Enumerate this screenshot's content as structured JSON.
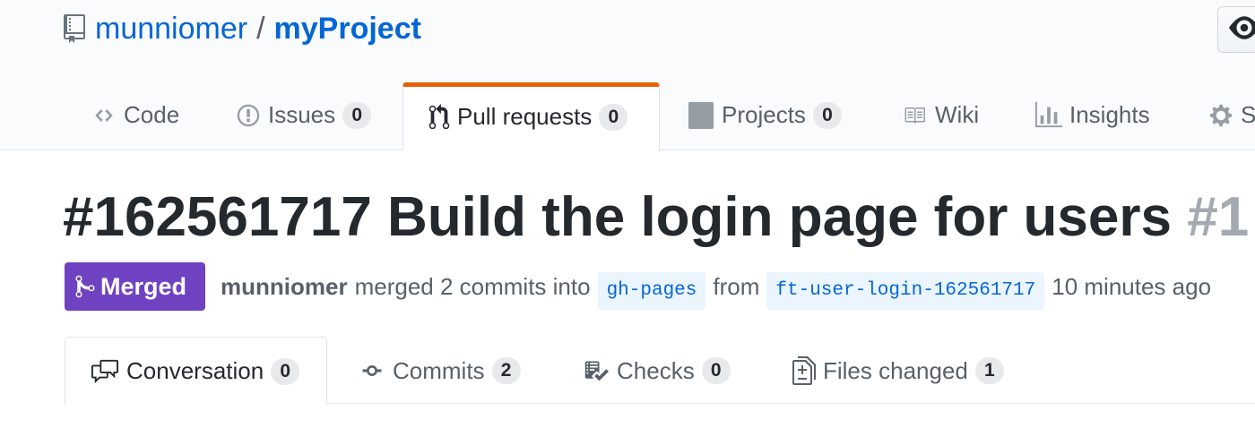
{
  "repo": {
    "owner": "munniomer",
    "separator": "/",
    "name": "myProject",
    "watch_icon": "eye-icon"
  },
  "reponav": {
    "items": [
      {
        "label": "Code",
        "icon": "code-icon",
        "count": null
      },
      {
        "label": "Issues",
        "icon": "issue-icon",
        "count": "0"
      },
      {
        "label": "Pull requests",
        "icon": "pull-request-icon",
        "count": "0",
        "selected": true
      },
      {
        "label": "Projects",
        "icon": "project-icon",
        "count": "0"
      },
      {
        "label": "Wiki",
        "icon": "book-icon",
        "count": null
      },
      {
        "label": "Insights",
        "icon": "graph-icon",
        "count": null
      },
      {
        "label": "S",
        "icon": "gear-icon",
        "count": null
      }
    ],
    "accent_color": "#e36209"
  },
  "pr": {
    "title": "#162561717 Build the login page for users",
    "number": "#1",
    "state": "Merged",
    "state_color": "#6f42c1",
    "author": "munniomer",
    "action": "merged 2 commits into",
    "base_branch": "gh-pages",
    "from_word": "from",
    "head_branch": "ft-user-login-162561717",
    "time": "10 minutes ago"
  },
  "tabs": [
    {
      "label": "Conversation",
      "icon": "comment-discussion-icon",
      "count": "0",
      "selected": true
    },
    {
      "label": "Commits",
      "icon": "git-commit-icon",
      "count": "2"
    },
    {
      "label": "Checks",
      "icon": "checklist-icon",
      "count": "0"
    },
    {
      "label": "Files changed",
      "icon": "diff-icon",
      "count": "1"
    }
  ]
}
